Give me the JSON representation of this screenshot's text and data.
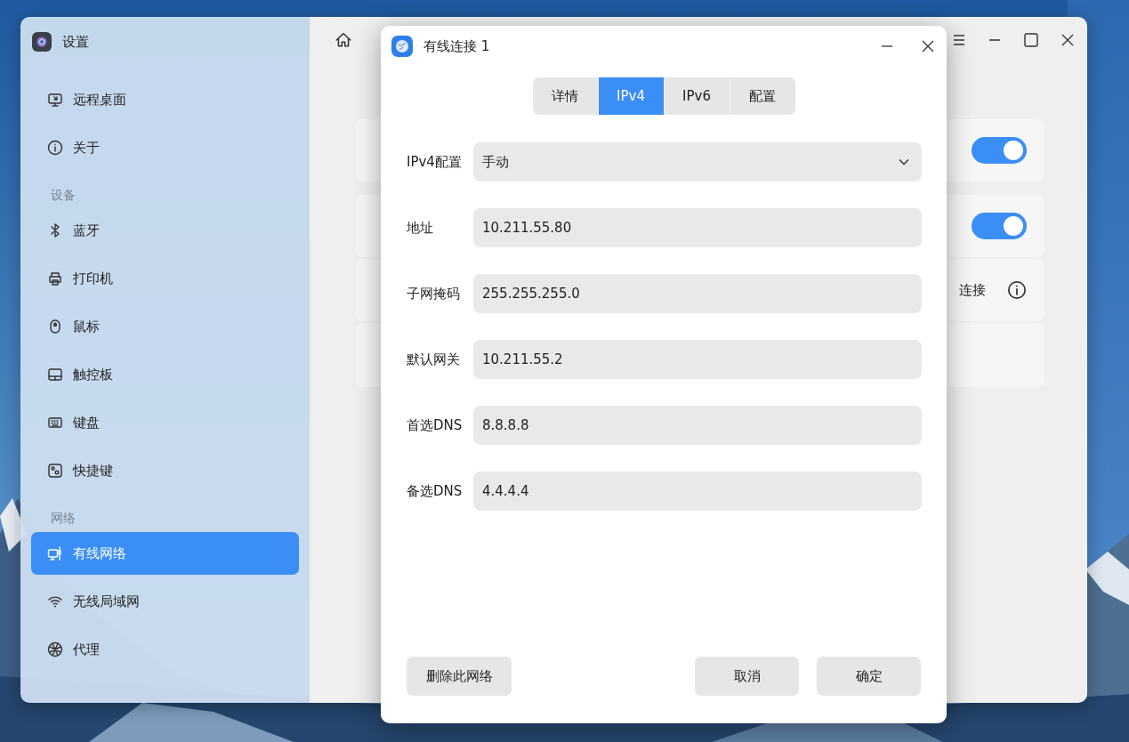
{
  "window": {
    "title": "设置"
  },
  "sidebar": {
    "items": [
      {
        "kind": "item",
        "label": "远程桌面",
        "selected": false
      },
      {
        "kind": "item",
        "label": "关于",
        "selected": false
      },
      {
        "kind": "header",
        "label": "设备"
      },
      {
        "kind": "item",
        "label": "蓝牙",
        "selected": false
      },
      {
        "kind": "item",
        "label": "打印机",
        "selected": false
      },
      {
        "kind": "item",
        "label": "鼠标",
        "selected": false
      },
      {
        "kind": "item",
        "label": "触控板",
        "selected": false
      },
      {
        "kind": "item",
        "label": "键盘",
        "selected": false
      },
      {
        "kind": "item",
        "label": "快捷键",
        "selected": false
      },
      {
        "kind": "header",
        "label": "网络"
      },
      {
        "kind": "item",
        "label": "有线网络",
        "selected": true
      },
      {
        "kind": "item",
        "label": "无线局域网",
        "selected": false
      },
      {
        "kind": "item",
        "label": "代理",
        "selected": false
      }
    ]
  },
  "content": {
    "cards": [
      {
        "kind": "toggle",
        "on": true
      },
      {
        "kind": "toggle",
        "on": true
      },
      {
        "kind": "link",
        "label": "连接"
      },
      {
        "kind": "blank"
      }
    ]
  },
  "dialog": {
    "title": "有线连接 1",
    "tabs": [
      {
        "label": "详情",
        "selected": false
      },
      {
        "label": "IPv4",
        "selected": true
      },
      {
        "label": "IPv6",
        "selected": false
      },
      {
        "label": "配置",
        "selected": false
      }
    ],
    "fields": [
      {
        "kind": "select",
        "label": "IPv4配置",
        "value": "手动"
      },
      {
        "kind": "input",
        "label": "地址",
        "value": "10.211.55.80"
      },
      {
        "kind": "input",
        "label": "子网掩码",
        "value": "255.255.255.0"
      },
      {
        "kind": "input",
        "label": "默认网关",
        "value": "10.211.55.2"
      },
      {
        "kind": "input",
        "label": "首选DNS",
        "value": "8.8.8.8"
      },
      {
        "kind": "input",
        "label": "备选DNS",
        "value": "4.4.4.4"
      }
    ],
    "buttons": [
      {
        "label": "删除此网络"
      },
      {
        "label": "取消"
      },
      {
        "label": "确定"
      }
    ]
  }
}
